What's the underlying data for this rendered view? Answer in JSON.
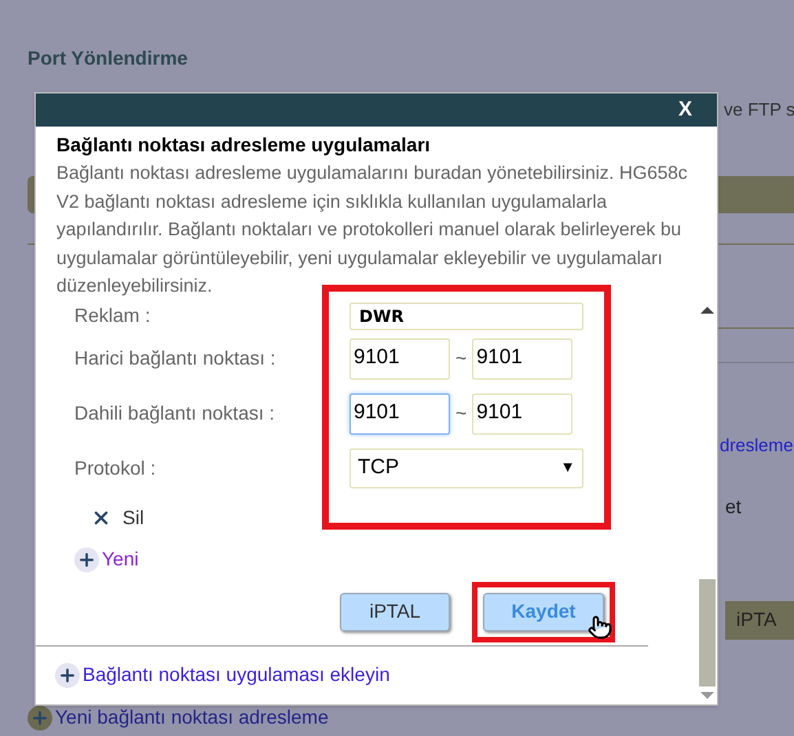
{
  "background": {
    "title": "Port Yönlendirme",
    "line_1_end": "ve FTP s",
    "link_fragment": "dresleme",
    "text_fragment": "et",
    "button_fragment": "iPTA",
    "add_link": "Yeni bağlantı noktası adresleme"
  },
  "dialog": {
    "close": "X",
    "heading": "Bağlantı noktası adresleme uygulamaları",
    "description": "Bağlantı noktası adresleme uygulamalarını buradan yönetebilirsiniz. HG658c V2 bağlantı noktası adresleme için sıklıkla kullanılan uygulamalarla yapılandırılır. Bağlantı noktaları ve protokolleri manuel olarak belirleyerek bu uygulamalar görüntüleyebilir, yeni uygulamalar ekleyebilir ve uygulamaları düzenleyebilirsiniz.",
    "fields_highlighted": true,
    "fields": [
      {
        "kind": "text",
        "label": "Reklam :",
        "value": "DWR"
      },
      {
        "kind": "range",
        "label": "Harici bağlantı noktası :",
        "from": "9101",
        "separator": "~",
        "to": "9101",
        "focused": false
      },
      {
        "kind": "range",
        "label": "Dahili bağlantı noktası :",
        "from": "9101",
        "separator": "~",
        "to": "9101",
        "focused": true
      },
      {
        "kind": "select",
        "label": "Protokol :",
        "value": "TCP",
        "arrow": "▼"
      }
    ],
    "delete_label": "Sil",
    "new_label": "Yeni",
    "buttons": [
      {
        "label": "iPTAL",
        "highlighted": false
      },
      {
        "label": "Kaydet",
        "highlighted": true
      }
    ],
    "add_app_link": "Bağlantı noktası uygulaması ekleyin"
  }
}
